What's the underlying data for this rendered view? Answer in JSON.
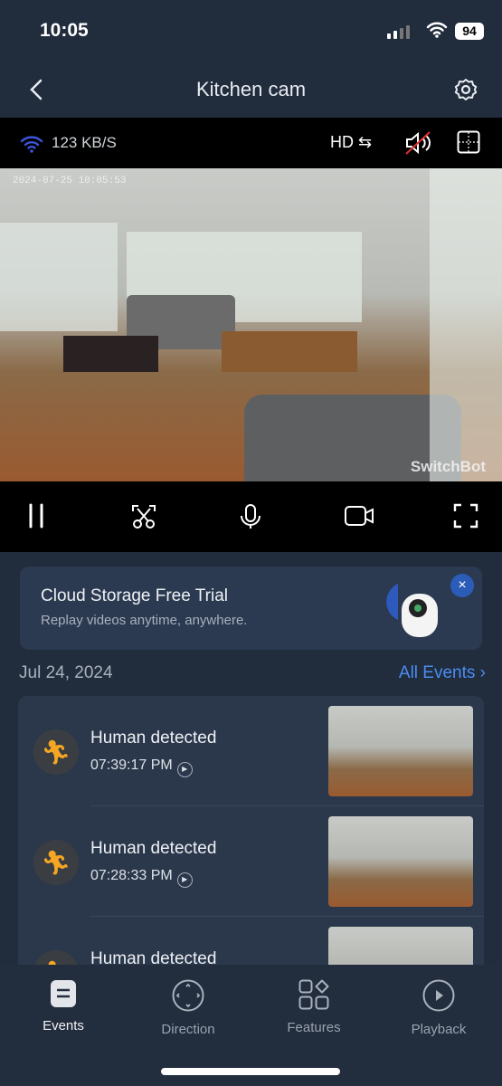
{
  "status_bar": {
    "time": "10:05",
    "battery": "94"
  },
  "header": {
    "title": "Kitchen cam"
  },
  "camera": {
    "bitrate": "123 KB/S",
    "quality": "HD",
    "timestamp": "2024-07-25 10:05:53",
    "watermark": "SwitchBot",
    "muted": true
  },
  "promo": {
    "title": "Cloud Storage Free Trial",
    "subtitle": "Replay videos anytime, anywhere.",
    "close": "×"
  },
  "events": {
    "date": "Jul 24, 2024",
    "all_events": "All Events",
    "items": [
      {
        "label": "Human detected",
        "time": "07:39:17 PM"
      },
      {
        "label": "Human detected",
        "time": "07:28:33 PM"
      },
      {
        "label": "Human detected",
        "time": ""
      }
    ]
  },
  "tabs": [
    {
      "label": "Events",
      "active": true
    },
    {
      "label": "Direction"
    },
    {
      "label": "Features"
    },
    {
      "label": "Playback"
    }
  ],
  "colors": {
    "accent": "#4b8cf2",
    "event_icon": "#f5a623",
    "background": "#212c3c"
  }
}
